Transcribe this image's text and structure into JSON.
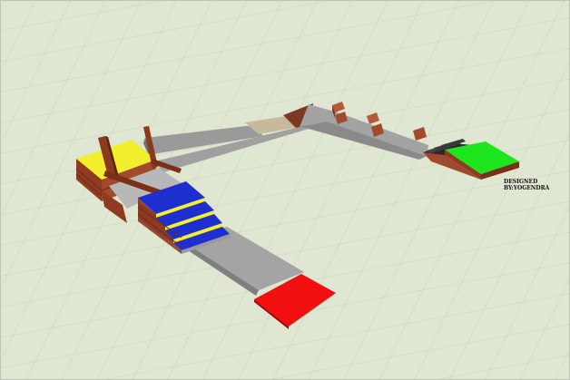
{
  "scene": {
    "credit_line1": "DESIGNED",
    "credit_line2": "BY:YOGENDRA"
  },
  "colors": {
    "ground": "#dfe6d2",
    "grid": "#c7d1bb",
    "concrete": "#9e9e9e",
    "concrete_dark": "#7f7f7f",
    "brick": "#8e3b22",
    "brick_light": "#b55a3a",
    "yellow": "#f3ef2c",
    "blue": "#1e2fd0",
    "red": "#f20f0f",
    "green": "#1ee61e",
    "tan": "#c9b99c",
    "dark_steps": "#222222"
  }
}
